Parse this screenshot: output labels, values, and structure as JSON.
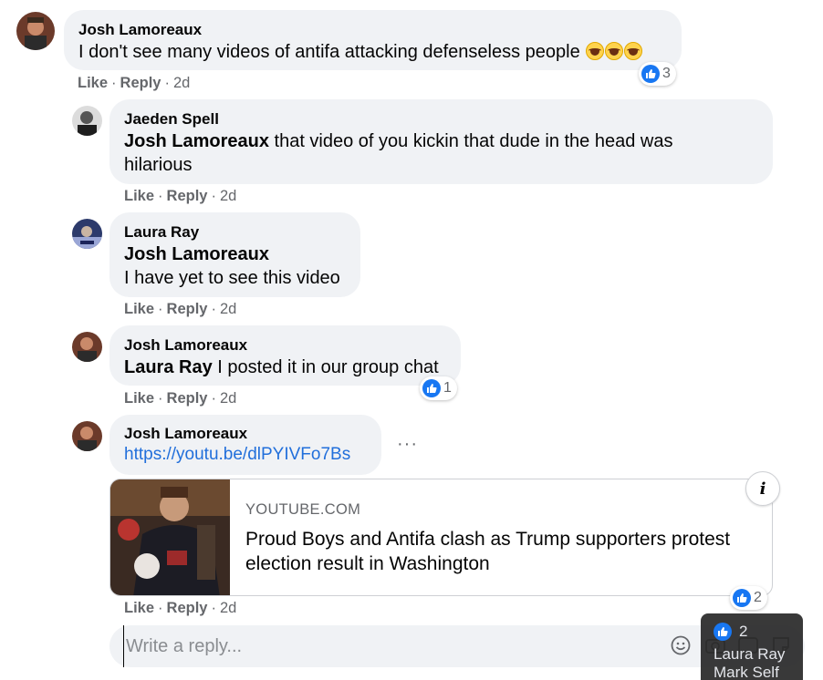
{
  "comments": [
    {
      "author": "Josh Lamoreaux",
      "text": "I don't see many videos of antifa attacking defenseless people",
      "like_label": "Like",
      "reply_label": "Reply",
      "time": "2d",
      "reaction_count": "3"
    },
    {
      "author": "Jaeden Spell",
      "mention": "Josh Lamoreaux",
      "text": "that video of you kickin that dude in the head was",
      "text2": "hilarious",
      "like_label": "Like",
      "reply_label": "Reply",
      "time": "2d"
    },
    {
      "author": "Laura Ray",
      "mention": "Josh Lamoreaux",
      "text": "I have yet to see this video",
      "like_label": "Like",
      "reply_label": "Reply",
      "time": "2d"
    },
    {
      "author": "Josh Lamoreaux",
      "mention": "Laura Ray",
      "text": "I posted it in our group chat",
      "like_label": "Like",
      "reply_label": "Reply",
      "time": "2d",
      "reaction_count": "1"
    },
    {
      "author": "Josh Lamoreaux",
      "link": "https://youtu.be/dlPYIVFo7Bs",
      "more": "···",
      "like_label": "Like",
      "reply_label": "Reply",
      "time": "2d",
      "reaction_count": "2"
    }
  ],
  "preview": {
    "domain": "YOUTUBE.COM",
    "title": "Proud Boys and Antifa clash as Trump supporters protest election result in Washington",
    "info_icon": "i"
  },
  "reply_box": {
    "placeholder": "Write a reply..."
  },
  "tooltip": {
    "count": "2",
    "names": [
      "Laura Ray",
      "Mark Self"
    ]
  },
  "colors": {
    "bubble": "#f0f2f5",
    "link": "#216fdb",
    "like_blue": "#1877f2",
    "meta_gray": "#65676b"
  }
}
